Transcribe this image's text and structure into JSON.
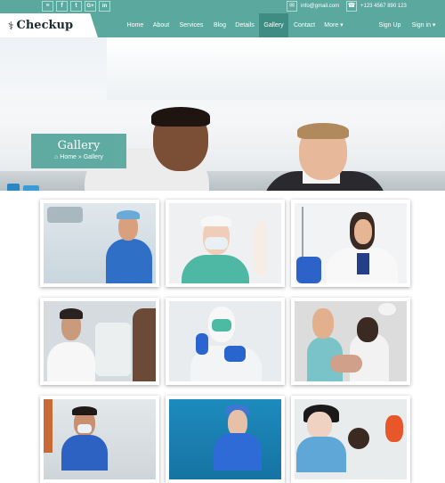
{
  "topbar": {
    "social": [
      {
        "icon": "rss-icon",
        "glyph": "≡"
      },
      {
        "icon": "facebook-icon",
        "glyph": "f"
      },
      {
        "icon": "twitter-icon",
        "glyph": "t"
      },
      {
        "icon": "google-plus-icon",
        "glyph": "G+"
      },
      {
        "icon": "linkedin-icon",
        "glyph": "in"
      }
    ],
    "email": "info@gmail.com",
    "phone": "+123 4567 890 123"
  },
  "logo": {
    "text": "Checkup",
    "icon": "stethoscope-icon"
  },
  "nav": {
    "items": [
      {
        "label": "Home"
      },
      {
        "label": "About"
      },
      {
        "label": "Services"
      },
      {
        "label": "Blog"
      },
      {
        "label": "Details"
      },
      {
        "label": "Gallery",
        "active": true
      },
      {
        "label": "Contact"
      },
      {
        "label": "More ▾"
      }
    ],
    "signup": "Sign Up",
    "signin": "Sign in ▾"
  },
  "hero": {
    "title": "Gallery",
    "breadcrumb": "⌂ Home » Gallery"
  },
  "colors": {
    "accent": "#5aa89e",
    "accent_dark": "#3f8c83"
  },
  "gallery": {
    "items": [
      {
        "name": "gallery-photo-doctor-blue-scrubs"
      },
      {
        "name": "gallery-photo-nurse-mask-gloves"
      },
      {
        "name": "gallery-photo-dentist-with-equipment"
      },
      {
        "name": "gallery-photo-eye-exam"
      },
      {
        "name": "gallery-photo-surgeon-blue-gloves"
      },
      {
        "name": "gallery-photo-dental-treatment"
      },
      {
        "name": "gallery-photo-lab-doctor"
      },
      {
        "name": "gallery-photo-surgeon-blue-background"
      },
      {
        "name": "gallery-photo-dentist-patient"
      }
    ]
  }
}
